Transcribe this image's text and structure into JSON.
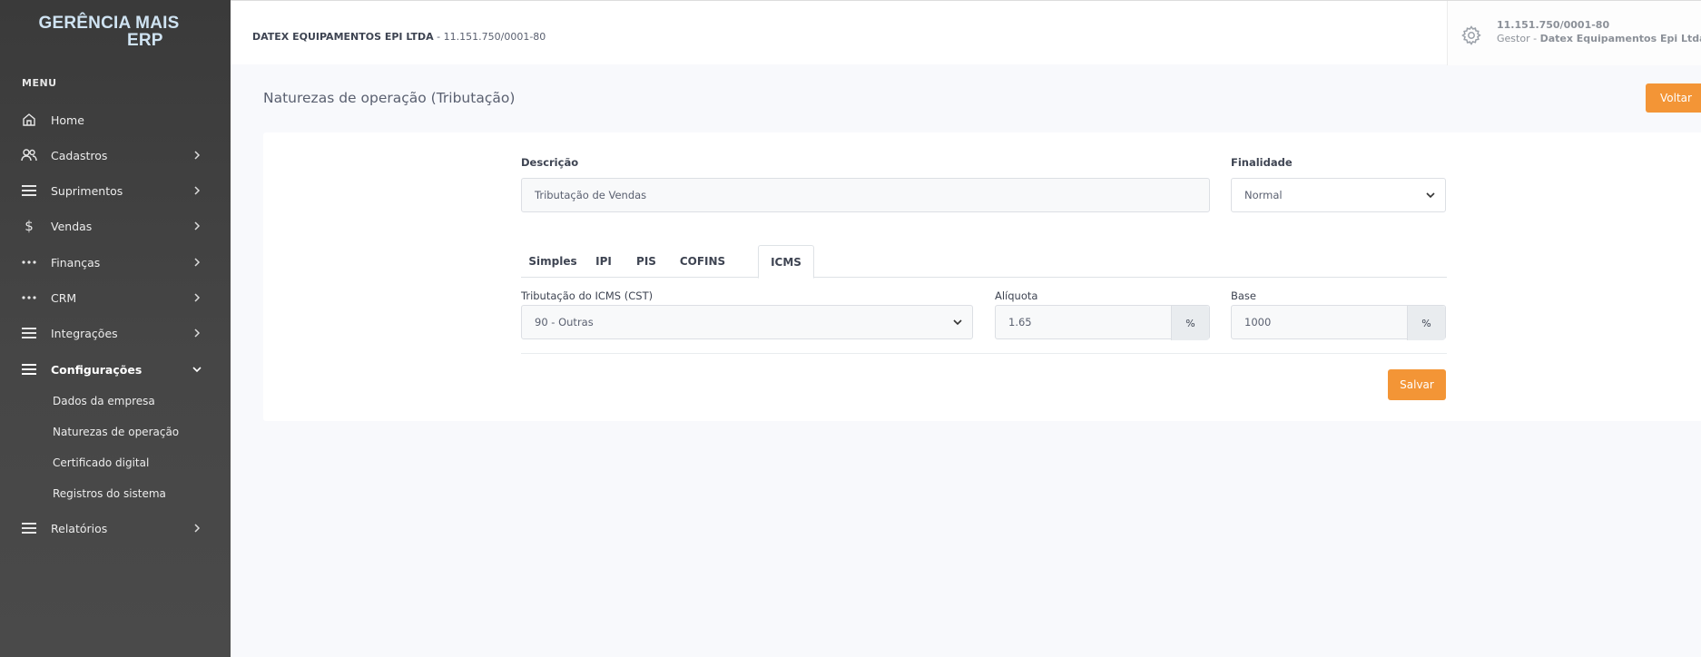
{
  "brand": {
    "line1": "GERÊNCIA MAIS",
    "line2": "ERP"
  },
  "sidebar": {
    "menu_heading": "MENU",
    "items": [
      {
        "label": "Home",
        "icon": "home-icon"
      },
      {
        "label": "Cadastros",
        "icon": "users-icon"
      },
      {
        "label": "Suprimentos",
        "icon": "menu-icon"
      },
      {
        "label": "Vendas",
        "icon": "dollar-icon"
      },
      {
        "label": "Finanças",
        "icon": "dots-icon"
      },
      {
        "label": "CRM",
        "icon": "dots-icon"
      },
      {
        "label": "Integrações",
        "icon": "menu-icon"
      },
      {
        "label": "Configurações",
        "icon": "menu-icon"
      },
      {
        "label": "Relatórios",
        "icon": "menu-icon"
      }
    ],
    "sub_items": [
      "Dados da empresa",
      "Naturezas de operação",
      "Certificado digital",
      "Registros do sistema"
    ]
  },
  "topbar": {
    "company_name": "DATEX EQUIPAMENTOS EPI LTDA",
    "company_cnpj": " - 11.151.750/0001-80",
    "user_cnpj": "11.151.750/0001-80",
    "user_role": "Gestor - ",
    "user_company": "Datex Equipamentos Epi Ltda"
  },
  "page": {
    "title": "Naturezas de operação (Tributação)",
    "back_label": "Voltar"
  },
  "form": {
    "descricao_label": "Descrição",
    "descricao_value": "Tributação de Vendas",
    "finalidade_label": "Finalidade",
    "finalidade_value": "Normal",
    "tabs": [
      "Simples",
      "IPI",
      "PIS",
      "COFINS",
      "ICMS"
    ],
    "active_tab": "ICMS",
    "cst_label": "Tributação do ICMS (CST)",
    "cst_value": "90 - Outras",
    "aliquota_label": "Alíquota",
    "aliquota_value": "1.65",
    "aliquota_unit": "%",
    "base_label": "Base",
    "base_value": "1000",
    "base_unit": "%",
    "save_label": "Salvar"
  },
  "colors": {
    "accent": "#f39536",
    "sidebar": "#3a3a3a",
    "background": "#f8f9fc"
  }
}
